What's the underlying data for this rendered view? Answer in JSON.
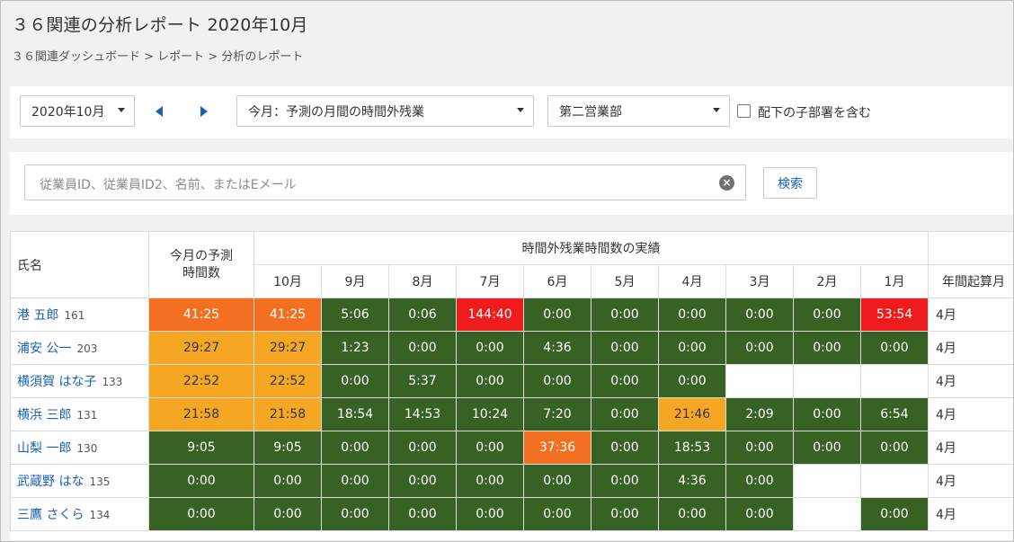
{
  "header": {
    "title": "３６関連の分析レポート 2020年10月",
    "breadcrumb": "３６関連ダッシュボード > レポート > 分析のレポート"
  },
  "toolbar": {
    "month_select": "2020年10月",
    "report_select": "今月：予測の月間の時間外残業",
    "dept_select": "第二営業部",
    "include_sub_label": "配下の子部署を含む",
    "include_sub_checked": false
  },
  "search": {
    "placeholder": "従業員ID、従業員ID2、名前、またはEメール",
    "button_label": "検索",
    "clear_icon": "close-circle-icon"
  },
  "colors": {
    "green": "#386223",
    "yellow": "#f5a623",
    "orange": "#f36f21",
    "red": "#ee1c1c",
    "link": "#1a5fb4"
  },
  "table": {
    "headers": {
      "name": "氏名",
      "forecast": "今月の予測\n時間数",
      "group": "時間外残業時間数の実績",
      "months": [
        "10月",
        "9月",
        "8月",
        "7月",
        "6月",
        "5月",
        "4月",
        "3月",
        "2月",
        "1月"
      ],
      "fiscal": "年間起算月"
    },
    "rows": [
      {
        "name": "港 五郎",
        "id": "161",
        "forecast": "41:25",
        "forecast_level": "o",
        "months": [
          "41:25",
          "5:06",
          "0:06",
          "144:40",
          "0:00",
          "0:00",
          "0:00",
          "0:00",
          "0:00",
          "53:54"
        ],
        "levels": [
          "o",
          "g",
          "g",
          "r",
          "g",
          "g",
          "g",
          "g",
          "g",
          "r"
        ],
        "fiscal": "4月"
      },
      {
        "name": "浦安 公一",
        "id": "203",
        "forecast": "29:27",
        "forecast_level": "y",
        "months": [
          "29:27",
          "1:23",
          "0:00",
          "0:00",
          "4:36",
          "0:00",
          "0:00",
          "0:00",
          "0:00",
          "0:00"
        ],
        "levels": [
          "y",
          "g",
          "g",
          "g",
          "g",
          "g",
          "g",
          "g",
          "g",
          "g"
        ],
        "fiscal": "4月"
      },
      {
        "name": "横須賀 はな子",
        "id": "133",
        "forecast": "22:52",
        "forecast_level": "y",
        "months": [
          "22:52",
          "0:00",
          "5:37",
          "0:00",
          "0:00",
          "0:00",
          "0:00",
          "",
          "",
          ""
        ],
        "levels": [
          "y",
          "g",
          "g",
          "g",
          "g",
          "g",
          "g",
          "w",
          "w",
          "w"
        ],
        "fiscal": "4月"
      },
      {
        "name": "横浜 三郎",
        "id": "131",
        "forecast": "21:58",
        "forecast_level": "y",
        "months": [
          "21:58",
          "18:54",
          "14:53",
          "10:24",
          "7:20",
          "0:00",
          "21:46",
          "2:09",
          "0:00",
          "6:54"
        ],
        "levels": [
          "y",
          "g",
          "g",
          "g",
          "g",
          "g",
          "y",
          "g",
          "g",
          "g"
        ],
        "fiscal": "4月"
      },
      {
        "name": "山梨 一郎",
        "id": "130",
        "forecast": "9:05",
        "forecast_level": "g",
        "months": [
          "9:05",
          "0:00",
          "0:00",
          "0:00",
          "37:36",
          "0:00",
          "18:53",
          "0:00",
          "0:00",
          "0:00"
        ],
        "levels": [
          "g",
          "g",
          "g",
          "g",
          "o",
          "g",
          "g",
          "g",
          "g",
          "g"
        ],
        "fiscal": "4月"
      },
      {
        "name": "武蔵野 はな",
        "id": "135",
        "forecast": "0:00",
        "forecast_level": "g",
        "months": [
          "0:00",
          "0:00",
          "0:00",
          "0:00",
          "0:00",
          "0:00",
          "4:36",
          "0:00",
          "",
          ""
        ],
        "levels": [
          "g",
          "g",
          "g",
          "g",
          "g",
          "g",
          "g",
          "g",
          "w",
          "w"
        ],
        "fiscal": "4月"
      },
      {
        "name": "三鷹 さくら",
        "id": "134",
        "forecast": "0:00",
        "forecast_level": "g",
        "months": [
          "0:00",
          "0:00",
          "0:00",
          "0:00",
          "0:00",
          "0:00",
          "0:00",
          "0:00",
          "",
          "0:00"
        ],
        "levels": [
          "g",
          "g",
          "g",
          "g",
          "g",
          "g",
          "g",
          "g",
          "w",
          "g"
        ],
        "fiscal": "4月"
      }
    ]
  }
}
